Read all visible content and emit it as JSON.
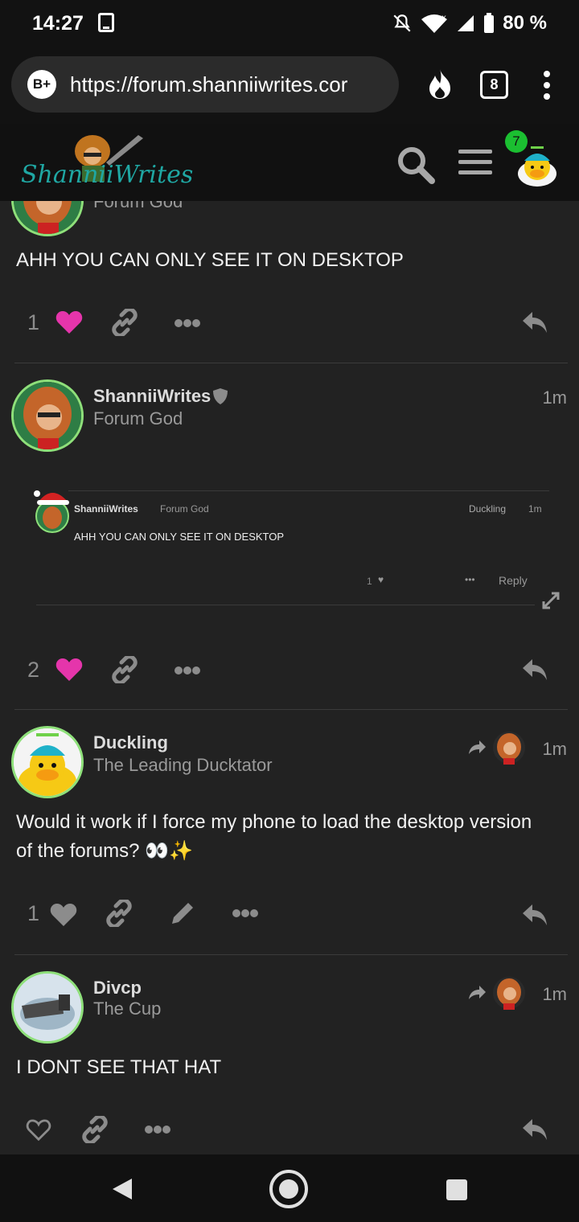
{
  "status_bar": {
    "time": "14:27",
    "battery": "80 %"
  },
  "browser": {
    "badge": "B+",
    "url": "https://forum.shanniiwrites.cor",
    "tab_count": "8"
  },
  "header": {
    "logo_text": "ShanniiWrites",
    "notification_count": "7"
  },
  "posts": [
    {
      "partial_user_title": "Forum God",
      "body": "AHH YOU CAN ONLY SEE IT ON DESKTOP",
      "like_count": "1"
    },
    {
      "username": "ShanniiWrites",
      "user_title": "Forum God",
      "time": "1m",
      "like_count": "2",
      "embed": {
        "username": "ShanniiWrites",
        "user_title": "Forum God",
        "reply_to": "Duckling",
        "time": "1m",
        "body": "AHH YOU CAN ONLY SEE IT ON DESKTOP",
        "like_count": "1",
        "reply_label": "Reply"
      }
    },
    {
      "username": "Duckling",
      "user_title": "The Leading Ducktator",
      "time": "1m",
      "body": "Would it work if I force my phone to load the desktop version of the forums? 👀✨",
      "like_count": "1"
    },
    {
      "username": "Divcp",
      "user_title": "The Cup",
      "time": "1m",
      "body": "I DONT SEE THAT HAT"
    }
  ],
  "colors": {
    "accent_green": "#8ee07a",
    "heart_pink": "#e535ab",
    "badge_green": "#1bbf31"
  }
}
